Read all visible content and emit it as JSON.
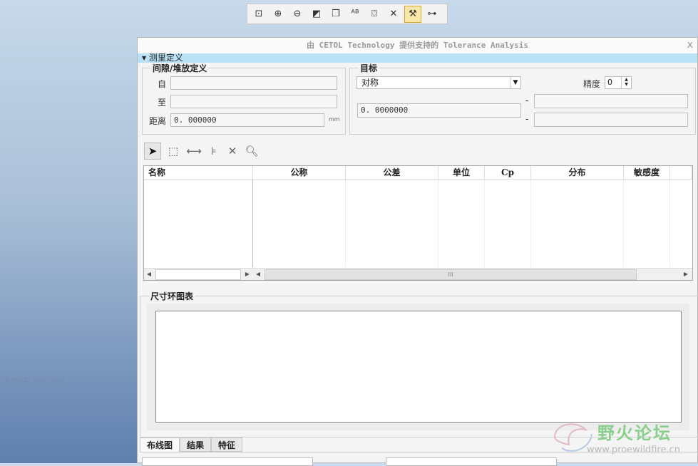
{
  "toolbar": {
    "icons": [
      "zoom-fit-icon",
      "zoom-in-icon",
      "zoom-out-icon",
      "repaint-icon",
      "view-orient-icon",
      "annotation-icon",
      "snapshot-icon",
      "dim-hide-icon",
      "datum-display-icon",
      "network-icon"
    ],
    "glyphs": [
      "⊡",
      "⊕",
      "⊖",
      "◩",
      "❒",
      "ᴬᴮ",
      "⌼",
      "✕",
      "⚒",
      "⊶"
    ],
    "active_index": 8
  },
  "status_text": "临时模型 XSEC0001",
  "dialog": {
    "title": "由 CETOL Technology 提供支持的 Tolerance Analysis",
    "close": "x",
    "section": "▾ 测里定义",
    "gap_group": {
      "legend": "间隙/堆放定义",
      "from_label": "自",
      "from_value": "",
      "to_label": "至",
      "to_value": "",
      "distance_label": "距离",
      "distance_value": "0. 000000",
      "unit": "mm"
    },
    "target_group": {
      "legend": "目标",
      "type_value": "对称",
      "precision_label": "精度",
      "precision_value": "0",
      "nominal_value": "0. 0000000",
      "upper_value": "",
      "lower_value": "",
      "dash1": "-",
      "dash2": "-"
    },
    "tools": [
      "select-arrow-icon",
      "add-box-icon",
      "add-dimension-icon",
      "add-stack-icon",
      "delete-icon",
      "inspect-icon"
    ],
    "tool_glyphs": [
      "➤",
      "⬚",
      "⟷",
      "⊧",
      "✕",
      "🔍︎"
    ],
    "table": {
      "headers": [
        "名称",
        "公称",
        "公差",
        "单位",
        "Cp",
        "分布",
        "敏感度"
      ],
      "scroll_mid": "III"
    },
    "chart_legend": "尺寸环图表",
    "tabs": [
      "布线图",
      "结果",
      "特征"
    ]
  },
  "watermark": {
    "title": "野火论坛",
    "url": "www.proewildfire.cn"
  }
}
